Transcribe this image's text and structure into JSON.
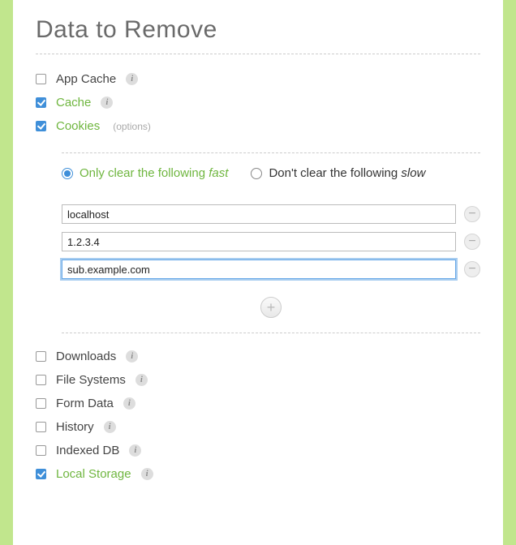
{
  "title": "Data to Remove",
  "options_hint": "(options)",
  "items": {
    "app_cache": {
      "label": "App Cache",
      "checked": false,
      "active": false
    },
    "cache": {
      "label": "Cache",
      "checked": true,
      "active": true
    },
    "cookies": {
      "label": "Cookies",
      "checked": true,
      "active": true
    },
    "downloads": {
      "label": "Downloads",
      "checked": false,
      "active": false
    },
    "file_systems": {
      "label": "File Systems",
      "checked": false,
      "active": false
    },
    "form_data": {
      "label": "Form Data",
      "checked": false,
      "active": false
    },
    "history": {
      "label": "History",
      "checked": false,
      "active": false
    },
    "indexed_db": {
      "label": "Indexed DB",
      "checked": false,
      "active": false
    },
    "local_storage": {
      "label": "Local Storage",
      "checked": true,
      "active": true
    }
  },
  "clear_mode": {
    "only": {
      "label": "Only clear the following ",
      "speed": "fast",
      "selected": true
    },
    "dont": {
      "label": "Don't clear the following ",
      "speed": "slow",
      "selected": false
    }
  },
  "domains": {
    "0": "localhost",
    "1": "1.2.3.4",
    "2": "sub.example.com"
  },
  "info_glyph": "i",
  "minus_glyph": "−",
  "plus_glyph": "+"
}
